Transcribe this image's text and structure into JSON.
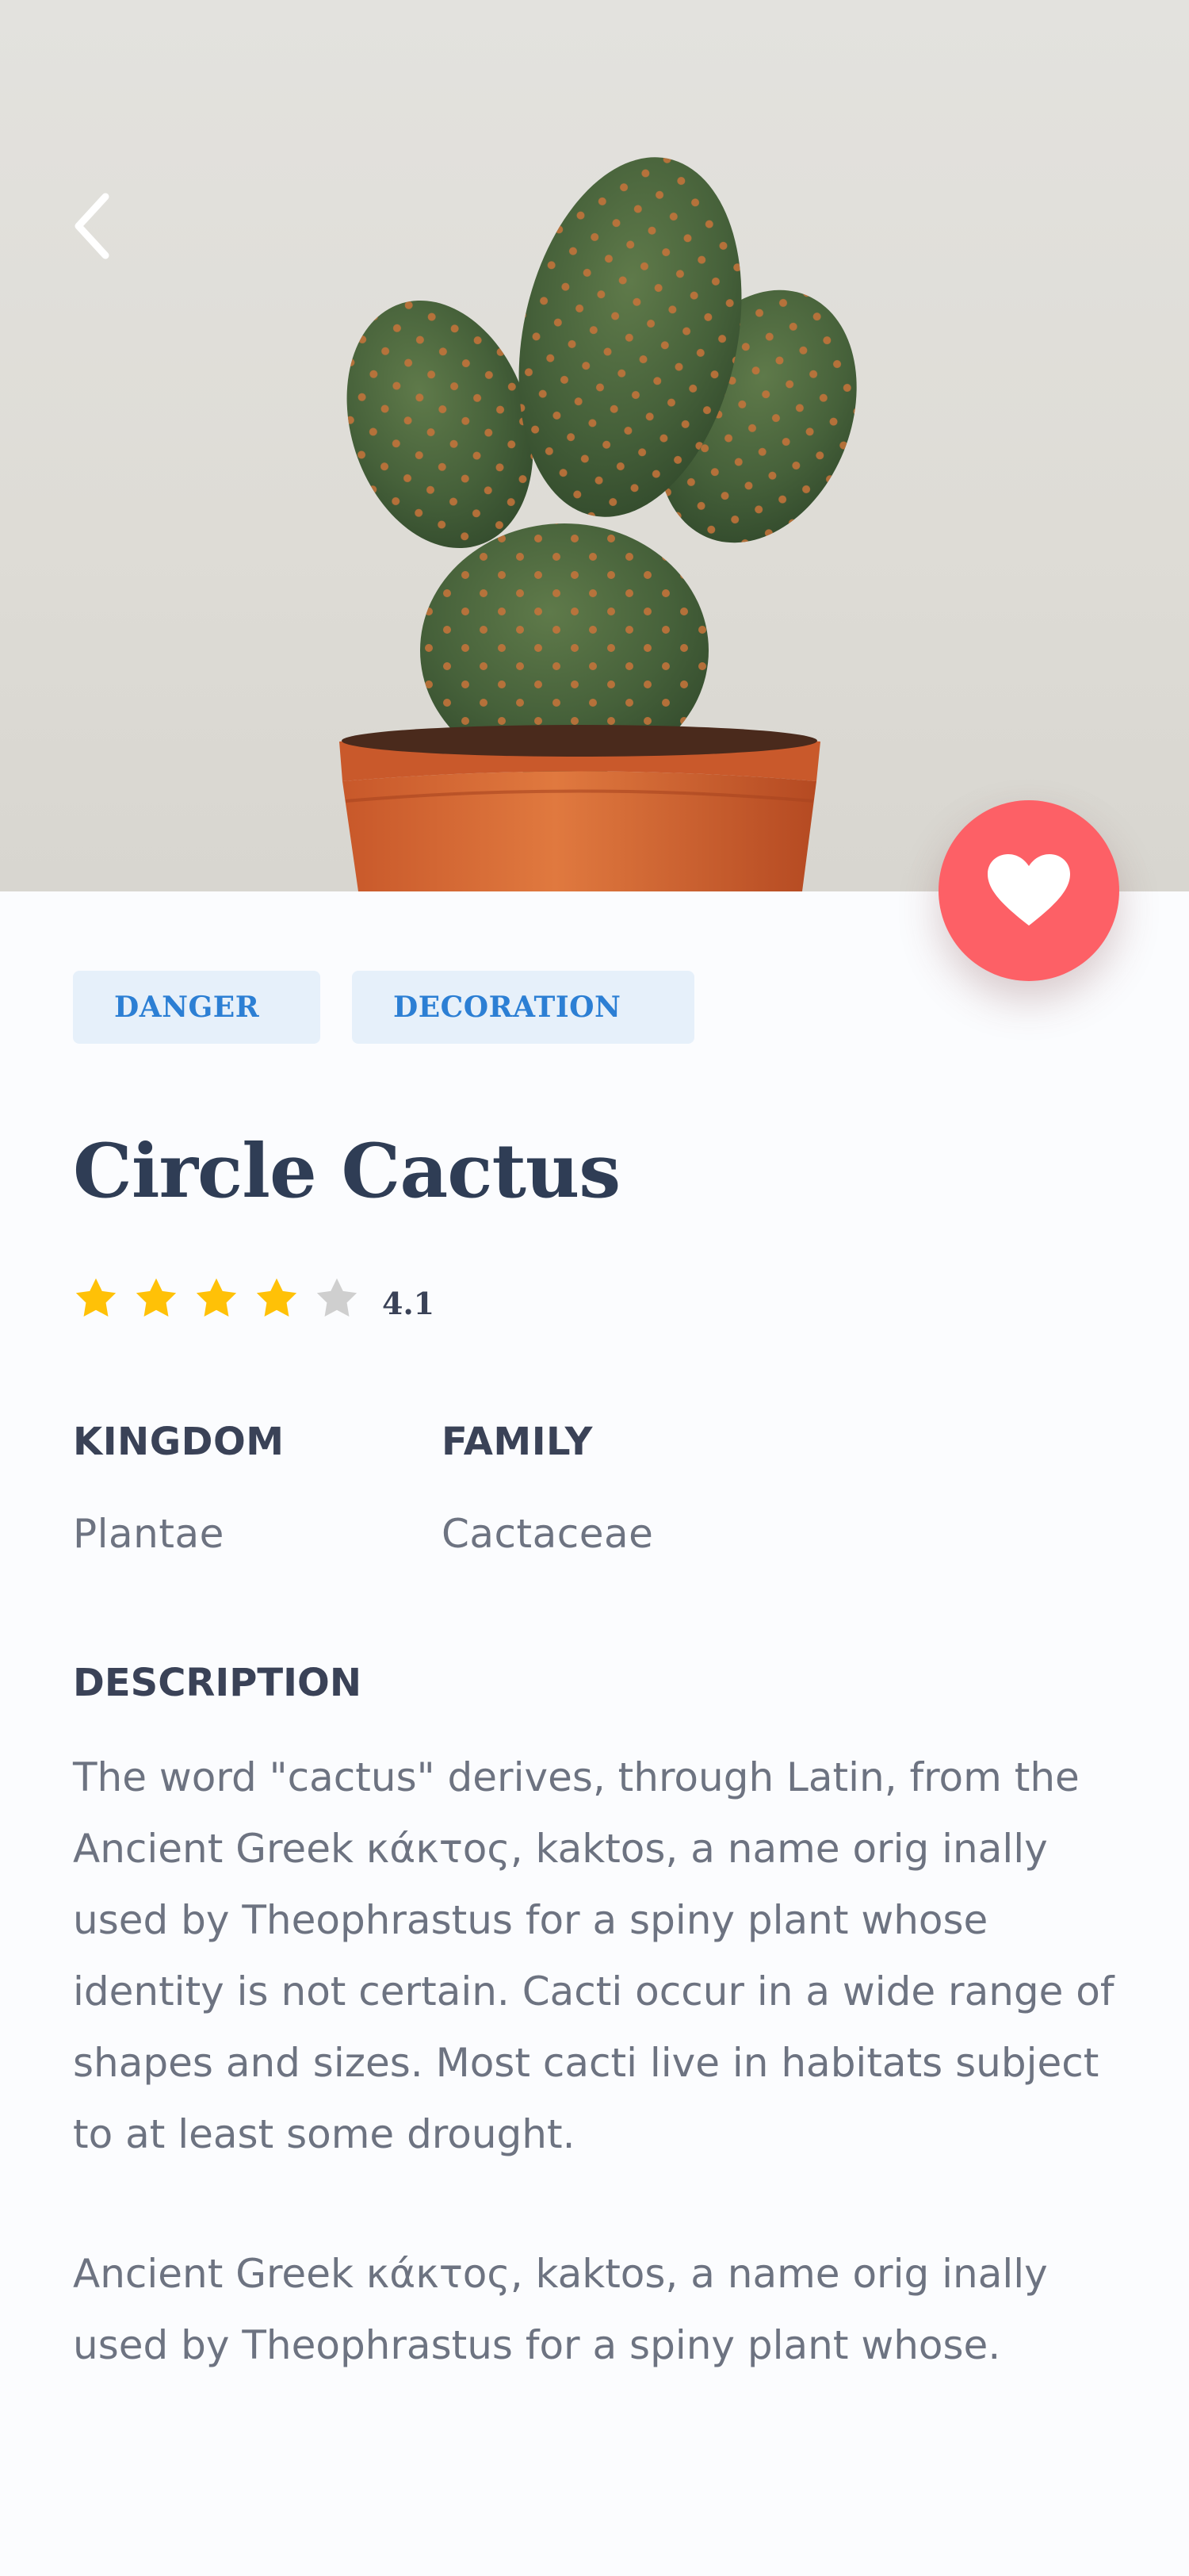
{
  "header": {
    "back_icon": "chevron-left-icon",
    "favorite_icon": "heart-icon",
    "accent_color": "#fd6066"
  },
  "plant": {
    "tags": [
      "DANGER",
      "DECORATION"
    ],
    "name": "Circle Cactus",
    "rating": {
      "value": "4.1",
      "stars_filled": 4,
      "stars_total": 5
    },
    "kingdom_label": "KINGDOM",
    "kingdom": "Plantae",
    "family_label": "FAMILY",
    "family": "Cactaceae",
    "description_label": "DESCRIPTION",
    "description": [
      "The word \"cactus\" derives, through Latin, from the Ancient Greek κάκτος, kaktos, a name orig inally used by Theophrastus for a spiny plant whose identity is not certain. Cacti occur in a wide range of shapes and sizes. Most cacti live in habitats subject to at least some drought.",
      "Ancient Greek κάκτος, kaktos, a name orig inally used by Theophrastus for a spiny plant whose."
    ]
  },
  "colors": {
    "tag_bg": "#e6f0fa",
    "tag_text": "#2c7fd4",
    "title": "#2f3d55",
    "star_filled": "#ffc107",
    "star_empty": "#cfcfcf",
    "body_text": "#6d7381"
  }
}
